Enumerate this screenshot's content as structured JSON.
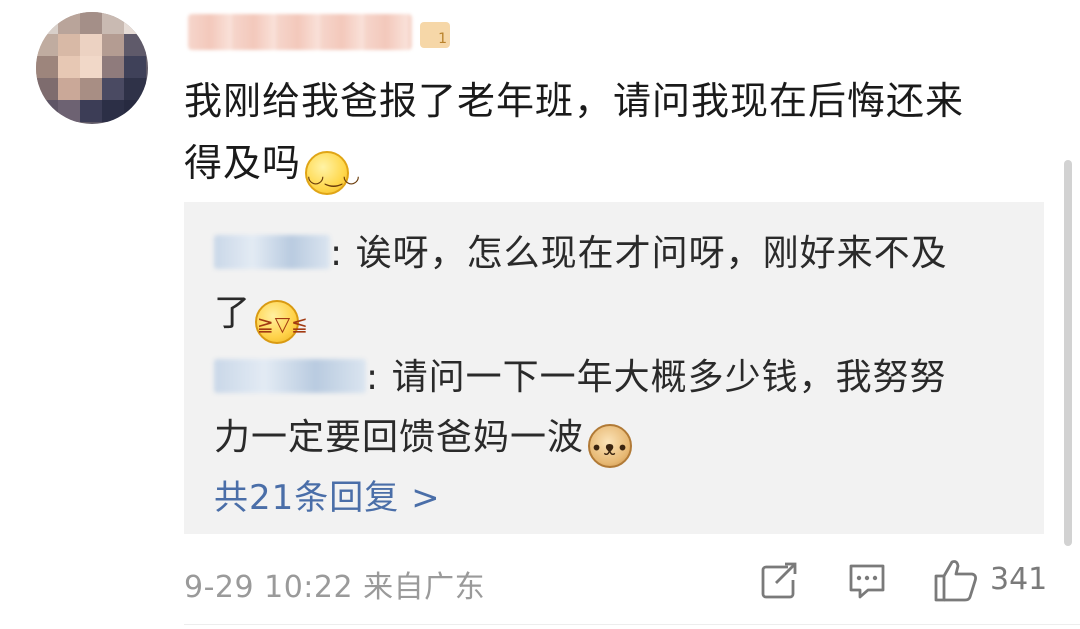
{
  "comment": {
    "line1": "我刚给我爸报了老年班，请问我现在后悔还来",
    "line2": "得及吗",
    "emoji_icon": "smug-grin-emoji"
  },
  "user": {
    "level_badge": "1"
  },
  "replies": [
    {
      "separator": ": ",
      "text": "诶呀，怎么现在才问呀，刚好来不及",
      "text_wrap": "了",
      "emoji_icon": "laugh-cry-emoji"
    },
    {
      "separator": ": ",
      "text": "请问一下一年大概多少钱，我努努",
      "text_wrap": "力一定要回馈爸妈一波",
      "emoji_icon": "doge-emoji"
    }
  ],
  "more_replies": "共21条回复 >",
  "footer": {
    "time": "9-29 10:22",
    "location": "来自广东",
    "like_count": "341",
    "share_icon": "share-icon",
    "comment_icon": "comment-icon",
    "like_icon": "thumbs-up-icon"
  }
}
